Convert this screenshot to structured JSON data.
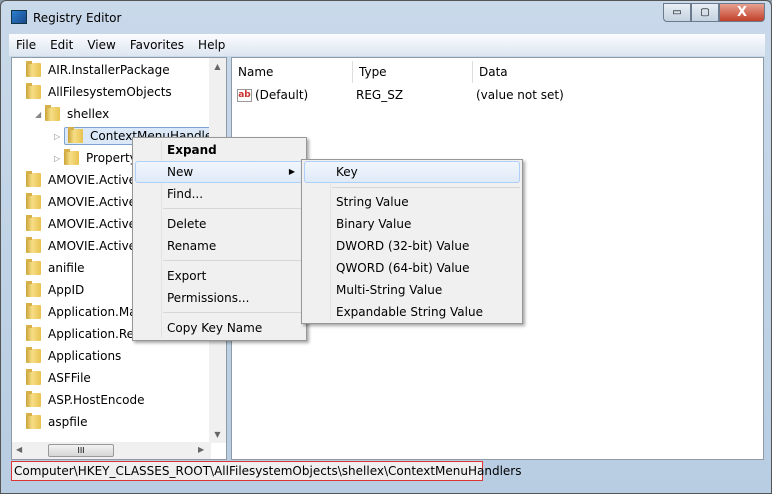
{
  "window": {
    "title": "Registry Editor",
    "minimize": "▭",
    "maximize": "▢",
    "close": "X"
  },
  "menu": [
    "File",
    "Edit",
    "View",
    "Favorites",
    "Help"
  ],
  "tree": [
    {
      "label": "AIR.InstallerPackage",
      "level": 0
    },
    {
      "label": "AllFilesystemObjects",
      "level": 0
    },
    {
      "label": "shellex",
      "level": 1,
      "expanded": true
    },
    {
      "label": "ContextMenuHandlers",
      "level": 2,
      "selected": true
    },
    {
      "label": "PropertyS",
      "level": 2
    },
    {
      "label": "AMOVIE.ActiveM",
      "level": 0
    },
    {
      "label": "AMOVIE.ActiveM",
      "level": 0
    },
    {
      "label": "AMOVIE.ActiveM",
      "level": 0
    },
    {
      "label": "AMOVIE.ActiveM",
      "level": 0
    },
    {
      "label": "anifile",
      "level": 0
    },
    {
      "label": "AppID",
      "level": 0
    },
    {
      "label": "Application.Manife",
      "level": 0
    },
    {
      "label": "Application.Refer",
      "level": 0
    },
    {
      "label": "Applications",
      "level": 0
    },
    {
      "label": "ASFFile",
      "level": 0
    },
    {
      "label": "ASP.HostEncode",
      "level": 0
    },
    {
      "label": "aspfile",
      "level": 0
    }
  ],
  "scroll_thumb": "III",
  "columns": [
    "Name",
    "Type",
    "Data"
  ],
  "values": [
    {
      "name": "(Default)",
      "type": "REG_SZ",
      "data": "(value not set)",
      "icon": "ab"
    }
  ],
  "context_menu": [
    "Expand",
    "New",
    "Find...",
    "Delete",
    "Rename",
    "Export",
    "Permissions...",
    "Copy Key Name"
  ],
  "submenu": [
    "Key",
    "String Value",
    "Binary Value",
    "DWORD (32-bit) Value",
    "QWORD (64-bit) Value",
    "Multi-String Value",
    "Expandable String Value"
  ],
  "status": "Computer\\HKEY_CLASSES_ROOT\\AllFilesystemObjects\\shellex\\ContextMenuHandlers"
}
